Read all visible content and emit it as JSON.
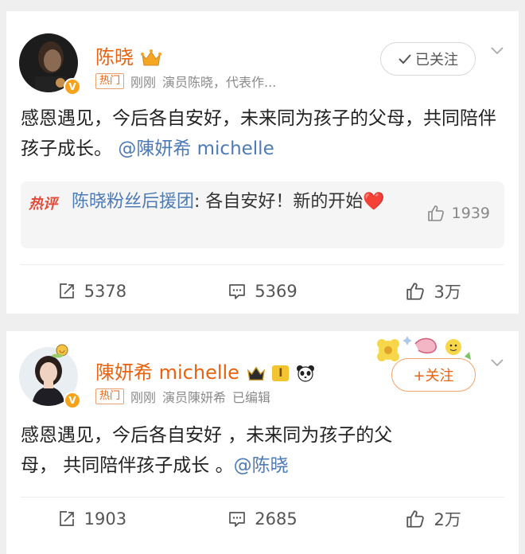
{
  "post1": {
    "username": "陈晓",
    "hot_tag": "热门",
    "time": "刚刚",
    "bio": "演员陈晓，代表作...",
    "follow_label": "已关注",
    "text": "感恩遇见，今后各自安好，未来同为孩子的父母，共同陪伴孩子成长。",
    "mention": "@陳妍希 michelle",
    "hot_comment": {
      "tag": "热评",
      "user": "陈晓粉丝后援团",
      "text": ": 各自安好！新的开始",
      "emoji": "❤️",
      "likes": "1939"
    },
    "reposts": "5378",
    "comments": "5369",
    "likes": "3万"
  },
  "post2": {
    "username": "陳妍希 michelle",
    "level_badge": "I",
    "hot_tag": "热门",
    "time": "刚刚",
    "bio": "演员陳妍希",
    "edited": "已编辑",
    "follow_label": "+关注",
    "text_line1": "感恩遇见，今后各自安好 ，未来同为孩子的父",
    "text_line2": "母， 共同陪伴孩子成长 。",
    "mention": "@陈晓",
    "reposts": "1903",
    "comments": "2685",
    "likes": "2万"
  },
  "colors": {
    "brand_orange": "#e8620f",
    "mention_blue": "#4d7bb5",
    "hot_red": "#e24a3a",
    "verified": "#f7a21b"
  }
}
